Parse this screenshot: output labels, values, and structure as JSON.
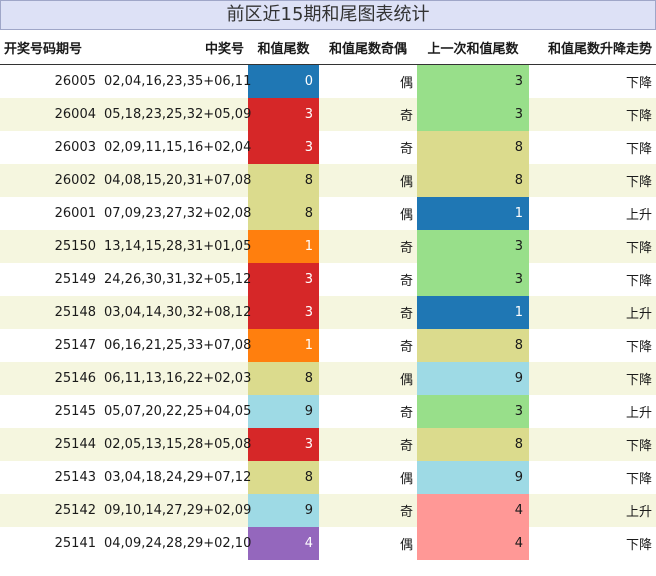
{
  "title": "前区近15期和尾图表统计",
  "headers": [
    "开奖号码期号",
    "中奖号",
    "和值尾数",
    "和值尾数奇偶",
    "上一次和值尾数",
    "和值尾数升降走势"
  ],
  "colors": {
    "0": "#1f77b4",
    "1": "#ff7f0e",
    "3": "#d62728",
    "4": "#9467bd",
    "8": "#dbdb8d",
    "9": "#9edae5",
    "row_odd": "#ffffff",
    "row_even": "#f5f6df",
    "prev_1": "#1f77b4",
    "prev_3": "#98df8a",
    "prev_4": "#ff9896",
    "prev_8": "#dbdb8d",
    "prev_9": "#9edae5"
  },
  "rows": [
    {
      "issue": "26005",
      "numbers": "02,04,16,23,35+06,11",
      "mantissa": "0",
      "parity": "偶",
      "prev": "3",
      "trend": "下降"
    },
    {
      "issue": "26004",
      "numbers": "05,18,23,25,32+05,09",
      "mantissa": "3",
      "parity": "奇",
      "prev": "3",
      "trend": "下降"
    },
    {
      "issue": "26003",
      "numbers": "02,09,11,15,16+02,04",
      "mantissa": "3",
      "parity": "奇",
      "prev": "8",
      "trend": "下降"
    },
    {
      "issue": "26002",
      "numbers": "04,08,15,20,31+07,08",
      "mantissa": "8",
      "parity": "偶",
      "prev": "8",
      "trend": "下降"
    },
    {
      "issue": "26001",
      "numbers": "07,09,23,27,32+02,08",
      "mantissa": "8",
      "parity": "偶",
      "prev": "1",
      "trend": "上升"
    },
    {
      "issue": "25150",
      "numbers": "13,14,15,28,31+01,05",
      "mantissa": "1",
      "parity": "奇",
      "prev": "3",
      "trend": "下降"
    },
    {
      "issue": "25149",
      "numbers": "24,26,30,31,32+05,12",
      "mantissa": "3",
      "parity": "奇",
      "prev": "3",
      "trend": "下降"
    },
    {
      "issue": "25148",
      "numbers": "03,04,14,30,32+08,12",
      "mantissa": "3",
      "parity": "奇",
      "prev": "1",
      "trend": "上升"
    },
    {
      "issue": "25147",
      "numbers": "06,16,21,25,33+07,08",
      "mantissa": "1",
      "parity": "奇",
      "prev": "8",
      "trend": "下降"
    },
    {
      "issue": "25146",
      "numbers": "06,11,13,16,22+02,03",
      "mantissa": "8",
      "parity": "偶",
      "prev": "9",
      "trend": "下降"
    },
    {
      "issue": "25145",
      "numbers": "05,07,20,22,25+04,05",
      "mantissa": "9",
      "parity": "奇",
      "prev": "3",
      "trend": "上升"
    },
    {
      "issue": "25144",
      "numbers": "02,05,13,15,28+05,08",
      "mantissa": "3",
      "parity": "奇",
      "prev": "8",
      "trend": "下降"
    },
    {
      "issue": "25143",
      "numbers": "03,04,18,24,29+07,12",
      "mantissa": "8",
      "parity": "偶",
      "prev": "9",
      "trend": "下降"
    },
    {
      "issue": "25142",
      "numbers": "09,10,14,27,29+02,09",
      "mantissa": "9",
      "parity": "奇",
      "prev": "4",
      "trend": "上升"
    },
    {
      "issue": "25141",
      "numbers": "04,09,24,28,29+02,10",
      "mantissa": "4",
      "parity": "偶",
      "prev": "4",
      "trend": "下降"
    }
  ]
}
